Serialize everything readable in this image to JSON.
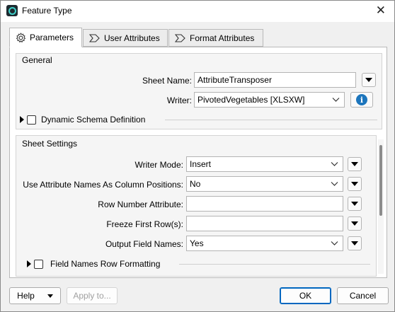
{
  "window": {
    "title": "Feature Type",
    "close_glyph": "✕"
  },
  "tabs": [
    {
      "label": "Parameters",
      "icon": "gear-icon",
      "active": true
    },
    {
      "label": "User Attributes",
      "icon": "attributes-icon",
      "active": false
    },
    {
      "label": "Format Attributes",
      "icon": "attributes-icon",
      "active": false
    }
  ],
  "general": {
    "title": "General",
    "sheet_name_label": "Sheet Name:",
    "sheet_name_value": "AttributeTransposer",
    "writer_label": "Writer:",
    "writer_value": "PivotedVegetables [XLSXW]",
    "dynamic_schema_label": "Dynamic Schema Definition"
  },
  "sheet_settings": {
    "title": "Sheet Settings",
    "writer_mode_label": "Writer Mode:",
    "writer_mode_value": "Insert",
    "use_attr_names_label": "Use Attribute Names As Column Positions:",
    "use_attr_names_value": "No",
    "row_number_label": "Row Number Attribute:",
    "row_number_value": "",
    "freeze_first_label": "Freeze First Row(s):",
    "freeze_first_value": "",
    "output_field_names_label": "Output Field Names:",
    "output_field_names_value": "Yes",
    "field_names_formatting_label": "Field Names Row Formatting"
  },
  "footer": {
    "help_label": "Help",
    "apply_label": "Apply to...",
    "ok_label": "OK",
    "cancel_label": "Cancel"
  }
}
